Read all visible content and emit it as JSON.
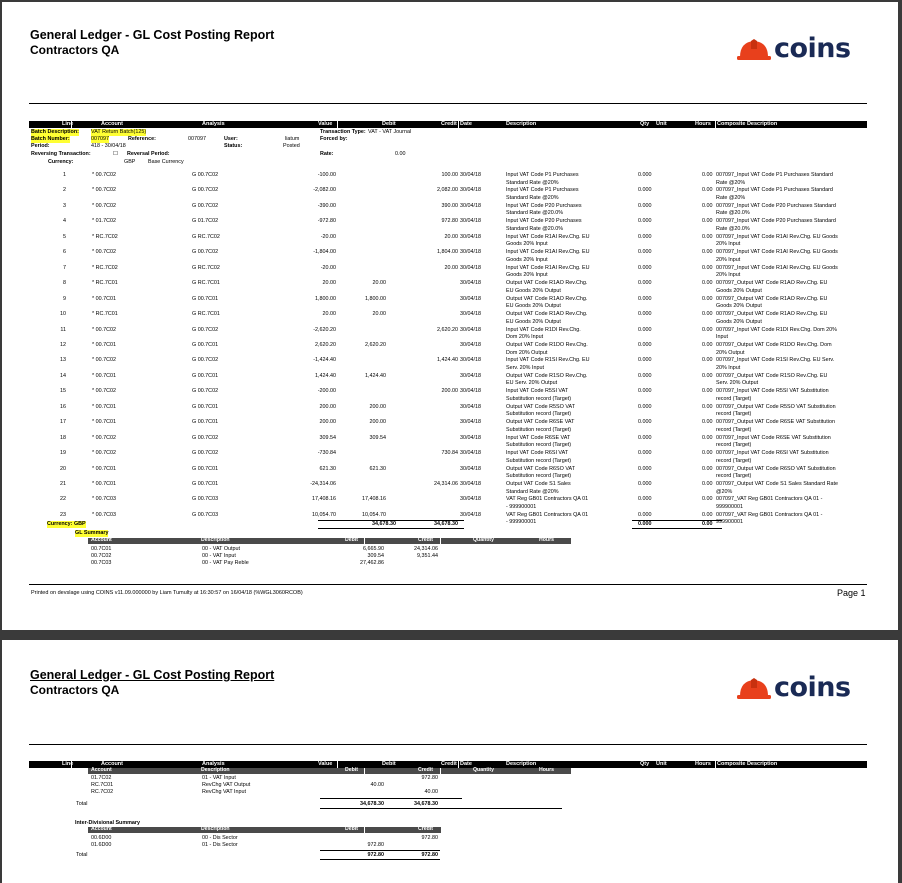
{
  "header": {
    "title": "General Ledger - GL Cost Posting Report",
    "subtitle": "Contractors QA",
    "logo_text": "COINS",
    "logo_color": "#e8401c"
  },
  "columns": {
    "line": "Line",
    "account": "Account",
    "analysis": "Analysis",
    "value": "Value",
    "debit": "Debit",
    "credit": "Credit",
    "date": "Date",
    "description": "Description",
    "qty": "Qty",
    "unit": "Unit",
    "hours": "Hours",
    "composite": "Composite Description"
  },
  "batch": {
    "desc_label": "Batch Description:",
    "desc_value": "VAT Return Batch(125)",
    "number_label": "Batch Number:",
    "number_value": "007097",
    "reference_label": "Reference:",
    "reference_value": "007097",
    "user_label": "User:",
    "user_value": "liatum",
    "period_label": "Period:",
    "period_value": "418 - 30/04/18",
    "status_label": "Status:",
    "status_value": "Posted",
    "reversing_label": "Reversing Transaction:",
    "reversing_value": "☐",
    "reversal_label": "Reversal Period:",
    "trans_type_label": "Transaction Type:",
    "trans_type_value": "VAT - VAT Journal",
    "forced_label": "Forced by:",
    "rate_label": "Rate:",
    "rate_value": "0.00",
    "currency_label": "Currency:",
    "currency_value": "GBP",
    "currency_desc": "Base Currency"
  },
  "lines": [
    {
      "n": "1",
      "acc": "* 00.7C02",
      "an": "G 00.7C02",
      "val": "-100.00",
      "dr": "",
      "cr": "100.00",
      "date": "30/04/18",
      "d1": "Input VAT Code P1 Purchases",
      "d2": "Standard Rate @20%",
      "qty": "0.000",
      "hrs": "0.00",
      "c1": "007097_Input VAT Code P1 Purchases Standard",
      "c2": "Rate @20%"
    },
    {
      "n": "2",
      "acc": "* 00.7C02",
      "an": "G 00.7C02",
      "val": "-2,082.00",
      "dr": "",
      "cr": "2,082.00",
      "date": "30/04/18",
      "d1": "Input VAT Code P1 Purchases",
      "d2": "Standard Rate @20%",
      "qty": "0.000",
      "hrs": "0.00",
      "c1": "007097_Input VAT Code P1 Purchases Standard",
      "c2": "Rate @20%"
    },
    {
      "n": "3",
      "acc": "* 00.7C02",
      "an": "G 00.7C02",
      "val": "-390.00",
      "dr": "",
      "cr": "390.00",
      "date": "30/04/18",
      "d1": "Input VAT Code P20 Purchases",
      "d2": "Standard Rate @20.0%",
      "qty": "0.000",
      "hrs": "0.00",
      "c1": "007097_Input VAT Code P20 Purchases Standard",
      "c2": "Rate @20.0%"
    },
    {
      "n": "4",
      "acc": "* 01.7C02",
      "an": "G 01.7C02",
      "val": "-972.80",
      "dr": "",
      "cr": "972.80",
      "date": "30/04/18",
      "d1": "Input VAT Code P20 Purchases",
      "d2": "Standard Rate @20.0%",
      "qty": "0.000",
      "hrs": "0.00",
      "c1": "007097_Input VAT Code P20 Purchases Standard",
      "c2": "Rate @20.0%"
    },
    {
      "n": "5",
      "acc": "* RC.7C02",
      "an": "G RC.7C02",
      "val": "-20.00",
      "dr": "",
      "cr": "20.00",
      "date": "30/04/18",
      "d1": "Input VAT Code R1AI Rev.Chg. EU",
      "d2": "Goods 20% Input",
      "qty": "0.000",
      "hrs": "0.00",
      "c1": "007097_Input VAT Code R1AI Rev.Chg. EU Goods",
      "c2": "20% Input"
    },
    {
      "n": "6",
      "acc": "* 00.7C02",
      "an": "G 00.7C02",
      "val": "-1,804.00",
      "dr": "",
      "cr": "1,804.00",
      "date": "30/04/18",
      "d1": "Input VAT Code R1AI Rev.Chg. EU",
      "d2": "Goods 20% Input",
      "qty": "0.000",
      "hrs": "0.00",
      "c1": "007097_Input VAT Code R1AI Rev.Chg. EU Goods",
      "c2": "20% Input"
    },
    {
      "n": "7",
      "acc": "* RC.7C02",
      "an": "G RC.7C02",
      "val": "-20.00",
      "dr": "",
      "cr": "20.00",
      "date": "30/04/18",
      "d1": "Input VAT Code R1AI Rev.Chg. EU",
      "d2": "Goods 20% Input",
      "qty": "0.000",
      "hrs": "0.00",
      "c1": "007097_Input VAT Code R1AI Rev.Chg. EU Goods",
      "c2": "20% Input"
    },
    {
      "n": "8",
      "acc": "* RC.7C01",
      "an": "G RC.7C01",
      "val": "20.00",
      "dr": "20.00",
      "cr": "",
      "date": "30/04/18",
      "d1": "Output VAT Code R1AO Rev.Chg.",
      "d2": "EU Goods 20% Output",
      "qty": "0.000",
      "hrs": "0.00",
      "c1": "007097_Output VAT Code R1AO Rev.Chg. EU",
      "c2": "Goods 20% Output"
    },
    {
      "n": "9",
      "acc": "* 00.7C01",
      "an": "G 00.7C01",
      "val": "1,800.00",
      "dr": "1,800.00",
      "cr": "",
      "date": "30/04/18",
      "d1": "Output VAT Code R1AO Rev.Chg.",
      "d2": "EU Goods 20% Output",
      "qty": "0.000",
      "hrs": "0.00",
      "c1": "007097_Output VAT Code R1AO Rev.Chg. EU",
      "c2": "Goods 20% Output"
    },
    {
      "n": "10",
      "acc": "* RC.7C01",
      "an": "G RC.7C01",
      "val": "20.00",
      "dr": "20.00",
      "cr": "",
      "date": "30/04/18",
      "d1": "Output VAT Code R1AO Rev.Chg.",
      "d2": "EU Goods 20% Output",
      "qty": "0.000",
      "hrs": "0.00",
      "c1": "007097_Output VAT Code R1AO Rev.Chg. EU",
      "c2": "Goods 20% Output"
    },
    {
      "n": "11",
      "acc": "* 00.7C02",
      "an": "G 00.7C02",
      "val": "-2,620.20",
      "dr": "",
      "cr": "2,620.20",
      "date": "30/04/18",
      "d1": "Input VAT Code R1DI Rev.Chg.",
      "d2": "Dom 20% Input",
      "qty": "0.000",
      "hrs": "0.00",
      "c1": "007097_Input VAT Code R1DI Rev.Chg. Dom 20%",
      "c2": "Input"
    },
    {
      "n": "12",
      "acc": "* 00.7C01",
      "an": "G 00.7C01",
      "val": "2,620.20",
      "dr": "2,620.20",
      "cr": "",
      "date": "30/04/18",
      "d1": "Output VAT Code R1DO Rev.Chg.",
      "d2": "Dom 20% Output",
      "qty": "0.000",
      "hrs": "0.00",
      "c1": "007097_Output VAT Code R1DO Rev.Chg. Dom",
      "c2": "20% Output"
    },
    {
      "n": "13",
      "acc": "* 00.7C02",
      "an": "G 00.7C02",
      "val": "-1,424.40",
      "dr": "",
      "cr": "1,424.40",
      "date": "30/04/18",
      "d1": "Input VAT Code R1SI Rev.Chg. EU",
      "d2": "Serv. 20% Input",
      "qty": "0.000",
      "hrs": "0.00",
      "c1": "007097_Input VAT Code R1SI Rev.Chg. EU Serv.",
      "c2": "20% Input"
    },
    {
      "n": "14",
      "acc": "* 00.7C01",
      "an": "G 00.7C01",
      "val": "1,424.40",
      "dr": "1,424.40",
      "cr": "",
      "date": "30/04/18",
      "d1": "Output VAT Code R1SO Rev.Chg.",
      "d2": "EU Serv. 20% Output",
      "qty": "0.000",
      "hrs": "0.00",
      "c1": "007097_Output VAT Code R1SO Rev.Chg. EU",
      "c2": "Serv. 20% Output"
    },
    {
      "n": "15",
      "acc": "* 00.7C02",
      "an": "G 00.7C02",
      "val": "-200.00",
      "dr": "",
      "cr": "200.00",
      "date": "30/04/18",
      "d1": "Input VAT Code R5SI VAT",
      "d2": "Substitution record (Target)",
      "qty": "0.000",
      "hrs": "0.00",
      "c1": "007097_Input VAT Code R5SI VAT Substitution",
      "c2": "record (Target)"
    },
    {
      "n": "16",
      "acc": "* 00.7C01",
      "an": "G 00.7C01",
      "val": "200.00",
      "dr": "200.00",
      "cr": "",
      "date": "30/04/18",
      "d1": "Output VAT Code R5SO VAT",
      "d2": "Substitution record (Target)",
      "qty": "0.000",
      "hrs": "0.00",
      "c1": "007097_Output VAT Code R5SO VAT Substitution",
      "c2": "record (Target)"
    },
    {
      "n": "17",
      "acc": "* 00.7C01",
      "an": "G 00.7C01",
      "val": "200.00",
      "dr": "200.00",
      "cr": "",
      "date": "30/04/18",
      "d1": "Output VAT Code R6SE VAT",
      "d2": "Substitution record (Target)",
      "qty": "0.000",
      "hrs": "0.00",
      "c1": "007097_Output VAT Code R6SE VAT Substitution",
      "c2": "record (Target)"
    },
    {
      "n": "18",
      "acc": "* 00.7C02",
      "an": "G 00.7C02",
      "val": "309.54",
      "dr": "309.54",
      "cr": "",
      "date": "30/04/18",
      "d1": "Input VAT Code R6SE VAT",
      "d2": "Substitution record (Target)",
      "qty": "0.000",
      "hrs": "0.00",
      "c1": "007097_Input VAT Code R6SE VAT Substitution",
      "c2": "record (Target)"
    },
    {
      "n": "19",
      "acc": "* 00.7C02",
      "an": "G 00.7C02",
      "val": "-730.84",
      "dr": "",
      "cr": "730.84",
      "date": "30/04/18",
      "d1": "Input VAT Code R6SI VAT",
      "d2": "Substitution record (Target)",
      "qty": "0.000",
      "hrs": "0.00",
      "c1": "007097_Input VAT Code R6SI VAT Substitution",
      "c2": "record (Target)"
    },
    {
      "n": "20",
      "acc": "* 00.7C01",
      "an": "G 00.7C01",
      "val": "621.30",
      "dr": "621.30",
      "cr": "",
      "date": "30/04/18",
      "d1": "Output VAT Code R6SO VAT",
      "d2": "Substitution record (Target)",
      "qty": "0.000",
      "hrs": "0.00",
      "c1": "007097_Output VAT Code R6SO VAT Substitution",
      "c2": "record (Target)"
    },
    {
      "n": "21",
      "acc": "* 00.7C01",
      "an": "G 00.7C01",
      "val": "-24,314.06",
      "dr": "",
      "cr": "24,314.06",
      "date": "30/04/18",
      "d1": "Output VAT Code S1 Sales",
      "d2": "Standard Rate @20%",
      "qty": "0.000",
      "hrs": "0.00",
      "c1": "007097_Output VAT Code S1 Sales Standard Rate",
      "c2": "@20%"
    },
    {
      "n": "22",
      "acc": "* 00.7C03",
      "an": "G 00.7C03",
      "val": "17,408.16",
      "dr": "17,408.16",
      "cr": "",
      "date": "30/04/18",
      "d1": "VAT Reg GB01 Contractors QA 01",
      "d2": "- 999900001",
      "qty": "0.000",
      "hrs": "0.00",
      "c1": "007097_VAT Reg GB01 Contractors QA 01 -",
      "c2": "999900001"
    },
    {
      "n": "23",
      "acc": "* 00.7C03",
      "an": "G 00.7C03",
      "val": "10,054.70",
      "dr": "10,054.70",
      "cr": "",
      "date": "30/04/18",
      "d1": "VAT Reg GB01 Contractors QA 01",
      "d2": "- 999900001",
      "qty": "0.000",
      "hrs": "0.00",
      "c1": "007097_VAT Reg GB01 Contractors QA 01 -",
      "c2": "999900001"
    }
  ],
  "currency_total": {
    "label": "Currency: GBP",
    "debit": "34,678.30",
    "credit": "34,678.30",
    "qty": "0.000",
    "hours": "0.00"
  },
  "gl_summary": {
    "label": "GL Summary",
    "headers": {
      "account": "Account",
      "description": "Description",
      "debit": "Debit",
      "credit": "Credit",
      "quantity": "Quantity",
      "hours": "Hours"
    },
    "rows": [
      {
        "acc": "00.7C01",
        "desc": "00 - VAT Output",
        "dr": "6,665.90",
        "cr": "24,314.06"
      },
      {
        "acc": "00.7C02",
        "desc": "00 - VAT Input",
        "dr": "309.54",
        "cr": "9,351.44"
      },
      {
        "acc": "00.7C03",
        "desc": "00 - VAT Pay Reble",
        "dr": "27,462.86",
        "cr": ""
      }
    ]
  },
  "footer": {
    "printed": "Printed on devslage using COINS v11.09.000000 by Liam Tumulty at 16:30:57 on 16/04/18 (%WGL3060RCOB)",
    "page": "Page 1"
  },
  "page2": {
    "gl_rows": [
      {
        "acc": "01.7C02",
        "desc": "01 - VAT Input",
        "dr": "",
        "cr": "972.80"
      },
      {
        "acc": "RC.7C01",
        "desc": "RevChg VAT Output",
        "dr": "40.00",
        "cr": ""
      },
      {
        "acc": "RC.7C02",
        "desc": "RevChg VAT Input",
        "dr": "",
        "cr": "40.00"
      }
    ],
    "gl_total": {
      "label": "Total",
      "dr": "34,678.30",
      "cr": "34,678.30"
    },
    "inter_label": "Inter-Divisional Summary",
    "inter_headers": {
      "account": "Account",
      "description": "Description",
      "debit": "Debit",
      "credit": "Credit"
    },
    "inter_rows": [
      {
        "acc": "00.6D00",
        "desc": "00 - Dis Sector",
        "dr": "",
        "cr": "972.80"
      },
      {
        "acc": "01.6D00",
        "desc": "01 - Dis Sector",
        "dr": "972.80",
        "cr": ""
      }
    ],
    "inter_total": {
      "label": "Total",
      "dr": "972.80",
      "cr": "972.80"
    }
  }
}
